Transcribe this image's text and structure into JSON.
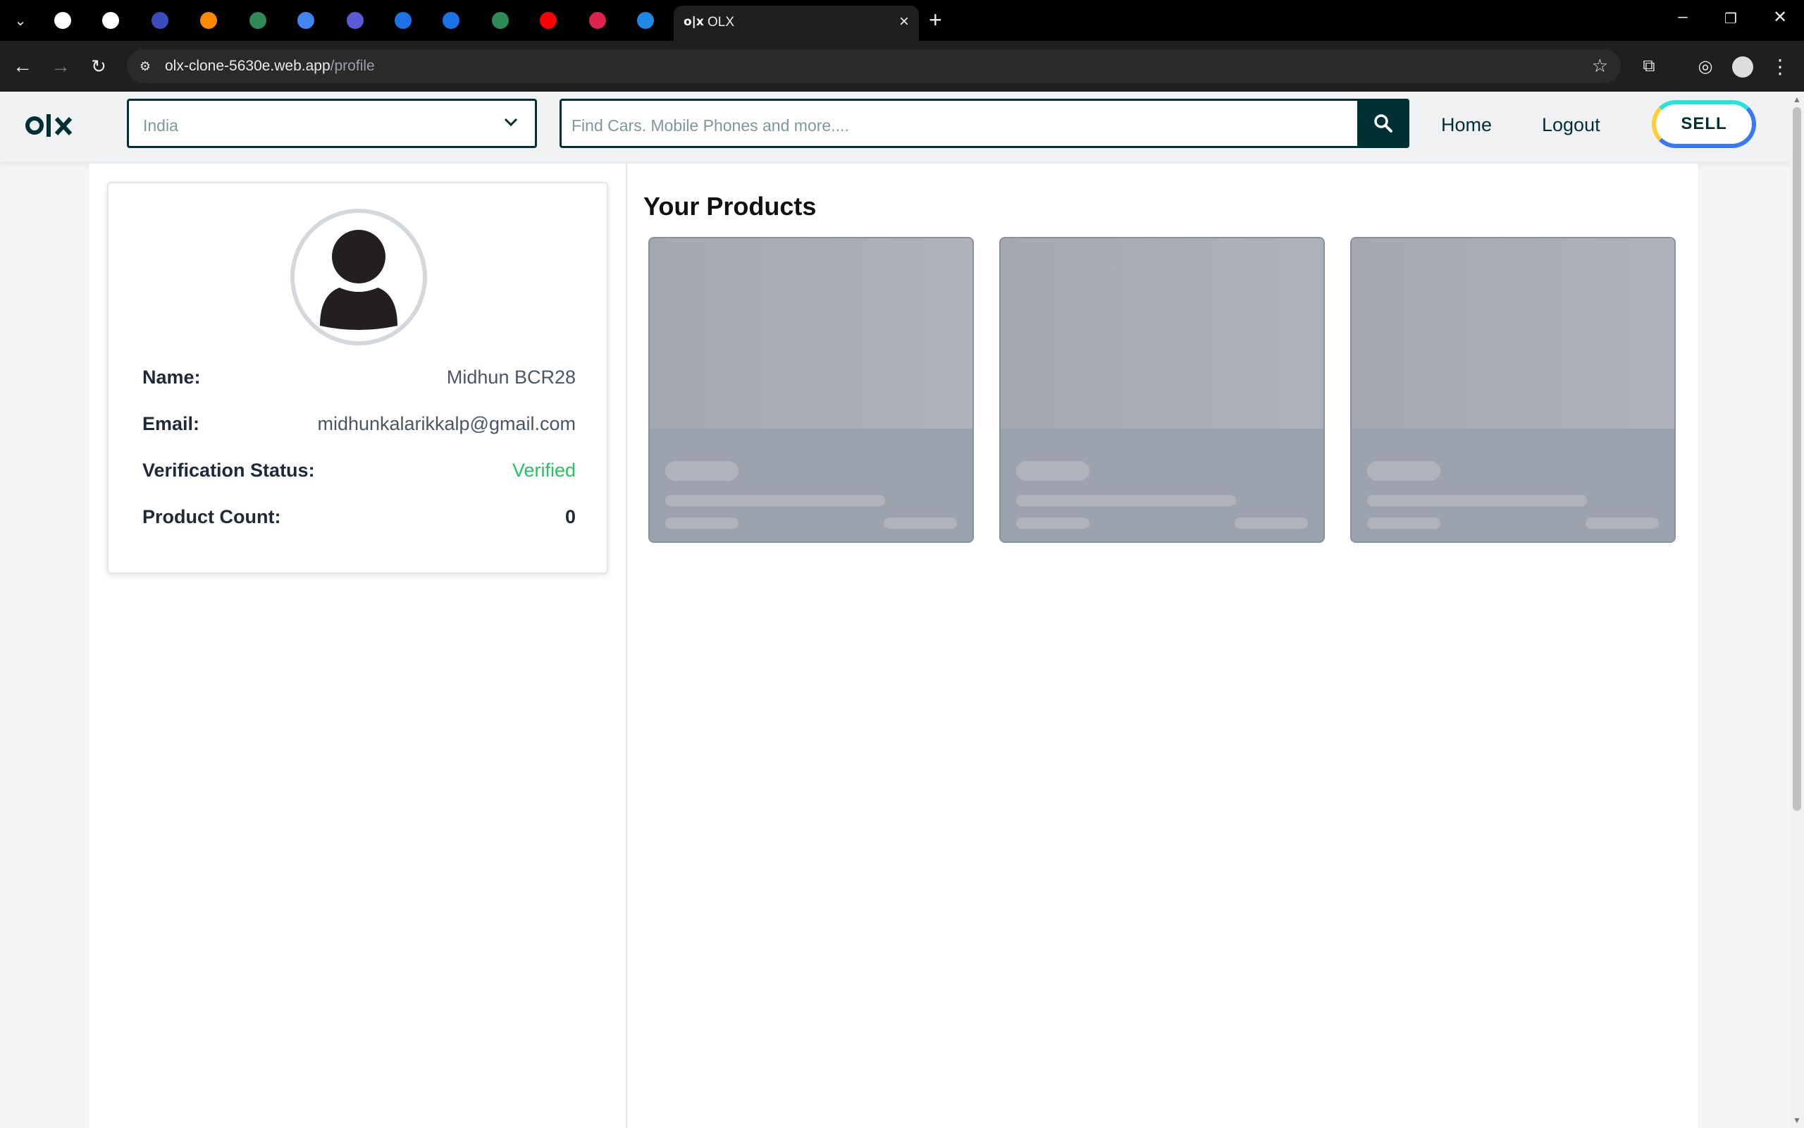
{
  "browser": {
    "active_tab_title": "OLX",
    "url_host": "olx-clone-5630e.web.app",
    "url_path": "/profile",
    "pinned_tabs": [
      {
        "icon": "spiral-app-icon",
        "color": "#ffffff"
      },
      {
        "icon": "bolt-app-icon",
        "color": "#ffffff"
      },
      {
        "icon": "bank-app-icon",
        "color": "#3b4cc0"
      },
      {
        "icon": "firebase-icon",
        "color": "#ff8a00"
      },
      {
        "icon": "globe-icon",
        "color": "#2e8b57"
      },
      {
        "icon": "docs-icon",
        "color": "#4285f4"
      },
      {
        "icon": "linear-app-icon",
        "color": "#5b5bd6"
      },
      {
        "icon": "browser-app-icon",
        "color": "#1a73e8"
      },
      {
        "icon": "browser-app-icon",
        "color": "#1a73e8"
      },
      {
        "icon": "globe-icon",
        "color": "#2e8b57"
      },
      {
        "icon": "youtube-icon",
        "color": "#ff0000"
      },
      {
        "icon": "nestjs-icon",
        "color": "#e0234e"
      },
      {
        "icon": "edit-app-icon",
        "color": "#1e88e5"
      }
    ]
  },
  "header": {
    "logo": "olx",
    "location_value": "India",
    "search_placeholder": "Find Cars. Mobile Phones and more....",
    "nav": {
      "home": "Home",
      "logout": "Logout"
    },
    "sell_label": "SELL"
  },
  "profile": {
    "fields": [
      {
        "label": "Name:",
        "value": "Midhun BCR28"
      },
      {
        "label": "Email:",
        "value": "midhunkalarikkalp@gmail.com"
      },
      {
        "label": "Verification Status:",
        "value": "Verified"
      },
      {
        "label": "Product Count:",
        "value": "0"
      }
    ]
  },
  "products": {
    "title": "Your Products",
    "skeleton_count": 3
  },
  "colors": {
    "brand": "#002f34",
    "verified": "#22c55e"
  }
}
